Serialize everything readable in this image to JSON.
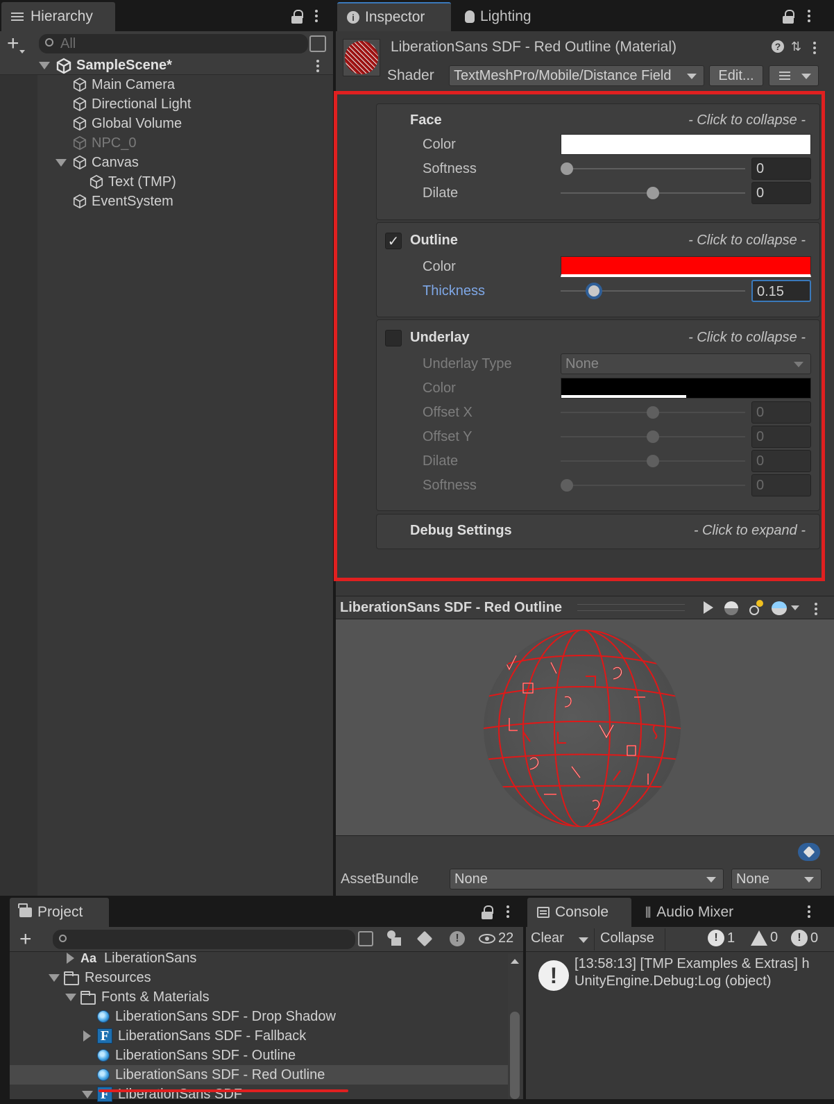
{
  "hierarchy": {
    "tab_label": "Hierarchy",
    "search_placeholder": "All",
    "scene_name": "SampleScene*",
    "items": [
      "Main Camera",
      "Directional Light",
      "Global Volume",
      "NPC_0",
      "Canvas",
      "Text (TMP)",
      "EventSystem"
    ]
  },
  "inspector": {
    "tabs": [
      "Inspector",
      "Lighting"
    ],
    "material_title": "LiberationSans SDF - Red Outline (Material)",
    "shader_label": "Shader",
    "shader_value": "TextMeshPro/Mobile/Distance Field",
    "edit_label": "Edit...",
    "collapse_hint": "- Click to collapse -",
    "expand_hint": "- Click to expand  -",
    "face": {
      "title": "Face",
      "color_label": "Color",
      "color": "#ffffff",
      "softness_label": "Softness",
      "softness": "0",
      "dilate_label": "Dilate",
      "dilate": "0"
    },
    "outline": {
      "title": "Outline",
      "enabled": true,
      "color_label": "Color",
      "color": "#ff0000",
      "thickness_label": "Thickness",
      "thickness": "0.15"
    },
    "underlay": {
      "title": "Underlay",
      "enabled": false,
      "type_label": "Underlay Type",
      "type_value": "None",
      "color_label": "Color",
      "color": "#000000",
      "offset_x_label": "Offset X",
      "offset_x": "0",
      "offset_y_label": "Offset Y",
      "offset_y": "0",
      "dilate_label": "Dilate",
      "dilate": "0",
      "softness_label": "Softness",
      "softness": "0"
    },
    "debug_title": "Debug Settings",
    "preview_title": "LiberationSans SDF - Red Outline",
    "assetbundle_label": "AssetBundle",
    "assetbundle_value": "None",
    "assetbundle_variant": "None"
  },
  "project": {
    "tab_label": "Project",
    "hidden_count": "22",
    "items": [
      {
        "label": "LiberationSans",
        "kind": "font"
      },
      {
        "label": "Resources",
        "kind": "folder"
      },
      {
        "label": "Fonts & Materials",
        "kind": "folder"
      },
      {
        "label": "LiberationSans SDF - Drop Shadow",
        "kind": "material"
      },
      {
        "label": "LiberationSans SDF - Fallback",
        "kind": "fontasset"
      },
      {
        "label": "LiberationSans SDF - Outline",
        "kind": "material"
      },
      {
        "label": "LiberationSans SDF - Red Outline",
        "kind": "material",
        "selected": true
      },
      {
        "label": "LiberationSans SDF",
        "kind": "fontasset"
      }
    ]
  },
  "console": {
    "tabs": [
      "Console",
      "Audio Mixer"
    ],
    "clear_label": "Clear",
    "collapse_label": "Collapse",
    "info_count": "1",
    "warn_count": "0",
    "error_count": "0",
    "log_line1": "[13:58:13] [TMP Examples & Extras] h",
    "log_line2": "UnityEngine.Debug:Log (object)"
  },
  "colors": {
    "highlight": "#e02020",
    "accent_blue": "#7ea7e6"
  }
}
